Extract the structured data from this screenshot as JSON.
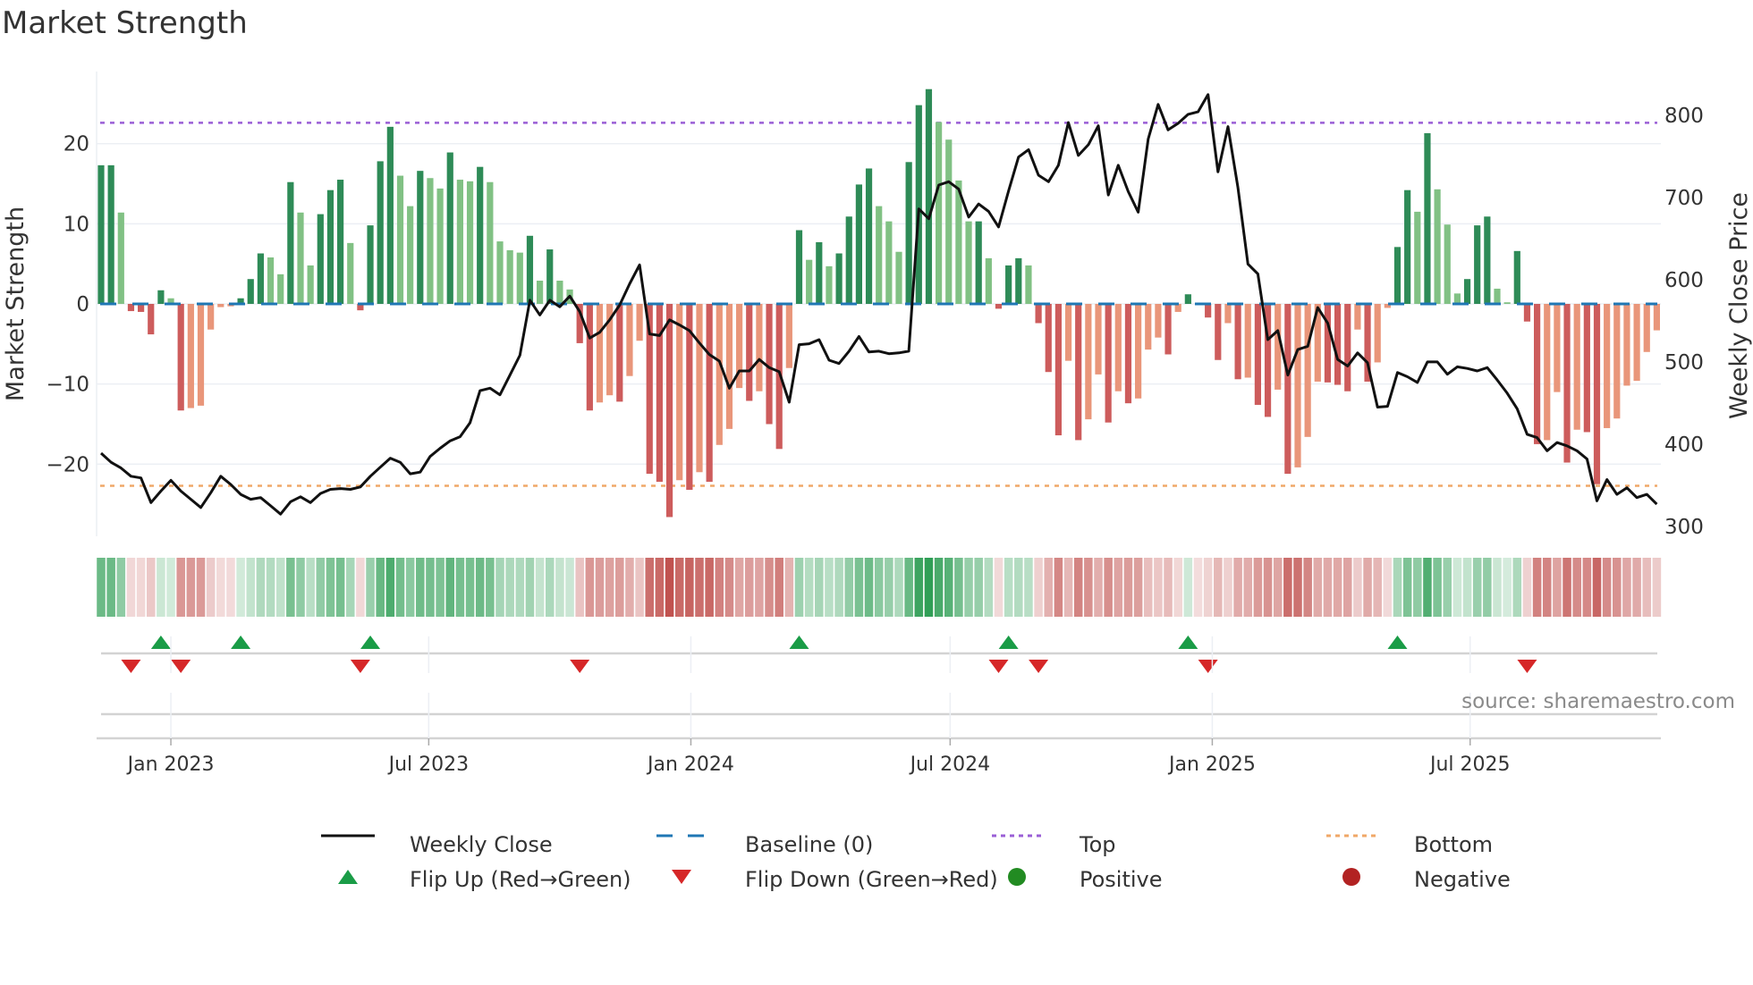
{
  "chart_data": {
    "type": "bar+line",
    "title": "Market Strength",
    "frequency": "weekly",
    "start_date": "2022-11-13",
    "ylabel_left": "Market Strength",
    "ylabel_right": "Weekly Close Price",
    "ylim_left": [
      -29,
      29
    ],
    "ylim_right": [
      288,
      853
    ],
    "yticks_left": [
      {
        "value": -20,
        "label": "−20"
      },
      {
        "value": -10,
        "label": "−10"
      },
      {
        "value": 0,
        "label": "0"
      },
      {
        "value": 10,
        "label": "10"
      },
      {
        "value": 20,
        "label": "20"
      }
    ],
    "yticks_right": [
      {
        "value": 300,
        "label": "300"
      },
      {
        "value": 400,
        "label": "400"
      },
      {
        "value": 500,
        "label": "500"
      },
      {
        "value": 600,
        "label": "600"
      },
      {
        "value": 700,
        "label": "700"
      },
      {
        "value": 800,
        "label": "800"
      }
    ],
    "xticks": [
      {
        "date": "2023-01-01",
        "label": "Jan 2023"
      },
      {
        "date": "2023-07-01",
        "label": "Jul 2023"
      },
      {
        "date": "2024-01-01",
        "label": "Jan 2024"
      },
      {
        "date": "2024-07-01",
        "label": "Jul 2024"
      },
      {
        "date": "2025-01-01",
        "label": "Jan 2025"
      },
      {
        "date": "2025-07-01",
        "label": "Jul 2025"
      }
    ],
    "grid": true,
    "levels": {
      "top": 22.6,
      "bottom": -22.7,
      "baseline": 0
    },
    "strength": [
      17.3,
      17.3,
      11.4,
      -0.9,
      -1,
      -3.8,
      1.7,
      0.7,
      -13.3,
      -13,
      -12.7,
      -3.2,
      -0.4,
      -0.3,
      0.7,
      3.1,
      6.3,
      5.8,
      3.7,
      15.2,
      11.4,
      4.8,
      11.2,
      14.2,
      15.5,
      7.6,
      -0.8,
      9.8,
      17.8,
      22.1,
      16,
      12.2,
      16.6,
      15.7,
      14.4,
      18.9,
      15.5,
      15.3,
      17.1,
      15.2,
      7.8,
      6.7,
      6.4,
      8.5,
      2.9,
      6.8,
      2.9,
      1.8,
      -4.9,
      -13.3,
      -12.3,
      -11.4,
      -12.2,
      -9,
      -4.6,
      -21.2,
      -22.2,
      -26.6,
      -22,
      -23.2,
      -21,
      -22.2,
      -17.6,
      -15.6,
      -10.5,
      -12.1,
      -10.9,
      -15,
      -18.1,
      -8,
      9.2,
      5.5,
      7.7,
      4.7,
      6.3,
      10.9,
      14.9,
      16.9,
      12.2,
      10.3,
      6.5,
      17.7,
      24.8,
      26.8,
      22.7,
      20.5,
      15.4,
      10.3,
      10.3,
      5.7,
      -0.6,
      4.8,
      5.7,
      4.8,
      -2.4,
      -8.5,
      -16.4,
      -7.1,
      -17,
      -14.4,
      -8.8,
      -14.8,
      -10.9,
      -12.4,
      -11.8,
      -5.7,
      -4.2,
      -6.3,
      -1.0,
      1.2,
      0,
      -1.7,
      -7,
      -2.4,
      -9.4,
      -9.2,
      -12.6,
      -14.1,
      -10.7,
      -21.2,
      -20.4,
      -16.6,
      -9.7,
      -9.8,
      -10.1,
      -10.9,
      -3.2,
      -9.7,
      -7.3,
      -0.5,
      7.1,
      14.2,
      11.5,
      21.3,
      14.3,
      9.9,
      1.3,
      3.1,
      9.8,
      10.9,
      1.9,
      0.2,
      6.6,
      -2.2,
      -17.5,
      -17,
      -11,
      -19.8,
      -15.7,
      -16,
      -22.5,
      -15.5,
      -14.3,
      -10.2,
      -9.6,
      -6,
      -3.3
    ],
    "weekly_close": [
      389,
      378,
      371,
      361,
      359,
      329,
      343,
      356,
      343,
      333,
      323,
      341,
      361,
      351,
      339,
      333,
      335,
      325,
      315,
      330,
      336,
      329,
      340,
      345,
      346,
      345,
      348,
      361,
      372,
      383,
      378,
      364,
      366,
      385,
      395,
      404,
      409,
      426,
      465,
      468,
      460,
      484,
      508,
      575,
      557,
      575,
      567,
      580,
      561,
      529,
      536,
      551,
      569,
      595,
      618,
      534,
      532,
      551,
      545,
      538,
      523,
      509,
      501,
      468,
      489,
      489,
      503,
      493,
      488,
      451,
      521,
      522,
      527,
      502,
      498,
      513,
      531,
      512,
      513,
      510,
      511,
      513,
      686,
      674,
      715,
      719,
      710,
      676,
      692,
      683,
      664,
      708,
      749,
      758,
      727,
      719,
      739,
      791,
      751,
      764,
      787,
      703,
      739,
      707,
      682,
      771,
      813,
      782,
      790,
      801,
      804,
      825,
      731,
      786,
      712,
      619,
      607,
      527,
      538,
      484,
      515,
      519,
      566,
      547,
      503,
      495,
      511,
      499,
      445,
      446,
      487,
      482,
      475,
      500,
      500,
      485,
      494,
      492,
      489,
      493,
      478,
      462,
      443,
      412,
      408,
      392,
      402,
      398,
      392,
      382,
      331,
      357,
      339,
      347,
      335,
      339,
      327
    ],
    "legend": [
      {
        "key": "weekly_close",
        "label": "Weekly Close"
      },
      {
        "key": "baseline",
        "label": "Baseline (0)"
      },
      {
        "key": "top",
        "label": "Top"
      },
      {
        "key": "bottom",
        "label": "Bottom"
      },
      {
        "key": "flip_up",
        "label": "Flip Up (Red→Green)"
      },
      {
        "key": "flip_down",
        "label": "Flip Down (Green→Red)"
      },
      {
        "key": "positive",
        "label": "Positive"
      },
      {
        "key": "negative",
        "label": "Negative"
      }
    ],
    "legend_placement": "bottom",
    "colors": {
      "bar_pos_strong": "#2e8b57",
      "bar_pos_weak": "#81c184",
      "bar_neg_strong": "#cd5c5c",
      "bar_neg_weak": "#e9967a",
      "line": "#111111",
      "baseline": "#1f77b4",
      "top": "#9a5fd6",
      "bottom": "#f0a868",
      "flip_up": "#1a9c47",
      "flip_down": "#d62728",
      "positive": "#228b22",
      "negative": "#b22222",
      "heat_pos": "#2f9e55",
      "heat_neg": "#c0504d"
    }
  },
  "source": "source: sharemaestro.com"
}
